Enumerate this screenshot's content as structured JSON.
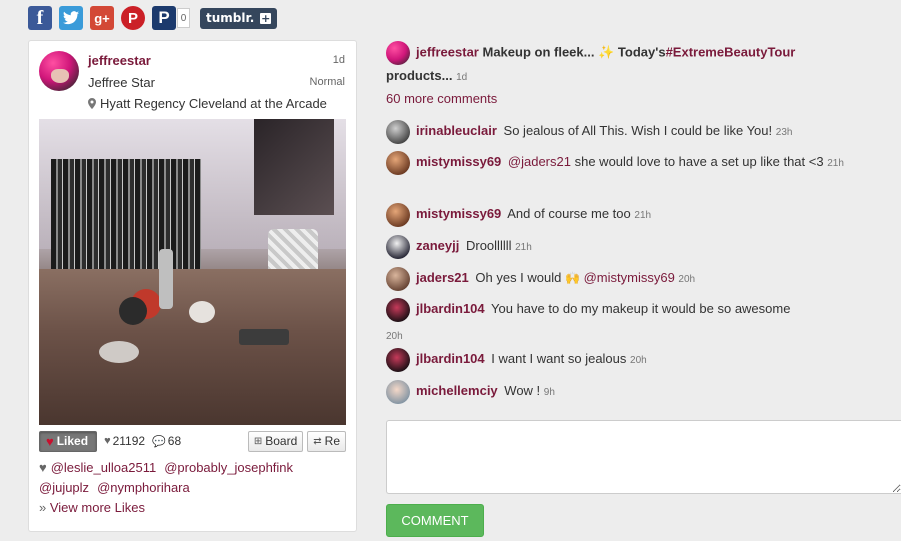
{
  "share": {
    "icons": [
      "facebook-icon",
      "twitter-icon",
      "google-plus-icon",
      "pinterest-icon",
      "pinboard-icon"
    ],
    "count": "0",
    "tumblr_label": "tumblr.",
    "tumblr_plus": "+"
  },
  "post": {
    "username": "jeffreestar",
    "full_name": "Jeffree Star",
    "age": "1d",
    "filter": "Normal",
    "location": "Hyatt Regency Cleveland at the Arcade",
    "liked_label": "Liked",
    "likes_count": "21192",
    "comments_count": "68",
    "board_label": "Board",
    "repost_label": "Re",
    "likers": [
      "@leslie_ulloa2511",
      "@probably_josephfink",
      "@jujuplz",
      "@nymphorihara"
    ],
    "view_more": "View more Likes",
    "view_more_prefix": "»"
  },
  "caption": {
    "username": "jeffreestar",
    "text_before": "Makeup on fleek...",
    "emoji": "✨",
    "text_mid": "Today's",
    "hashtag": "#ExtremeBeautyTour",
    "text_after": "products...",
    "time": "1d"
  },
  "more_comments": "60 more comments",
  "comments": [
    {
      "user": "irinableuclair",
      "text": "So jealous of All This. Wish I could be like You!",
      "time": "23h"
    },
    {
      "user": "mistymissy69",
      "mention": "@jaders21",
      "text": "she would love to have a set up like that <3",
      "time": "21h"
    },
    {
      "user": "mistymissy69",
      "text": "And of course me too",
      "time": "21h"
    },
    {
      "user": "zaneyjj",
      "text": "Droollllll",
      "time": "21h"
    },
    {
      "user": "jaders21",
      "text": "Oh yes I would",
      "emoji": "🙌",
      "mention": "@mistymissy69",
      "time": "20h"
    },
    {
      "user": "jlbardin104",
      "text": "You have to do my makeup it would be so awesome",
      "time": "20h"
    },
    {
      "user": "jlbardin104",
      "text": "I want I want so jealous",
      "time": "20h"
    },
    {
      "user": "michellemciy",
      "text": "Wow !",
      "time": "9h"
    }
  ],
  "comment_button": "COMMENT",
  "colors": {
    "username": "#7a1a3b",
    "comment_button": "#5cb85c",
    "liked_button": "#777777"
  }
}
